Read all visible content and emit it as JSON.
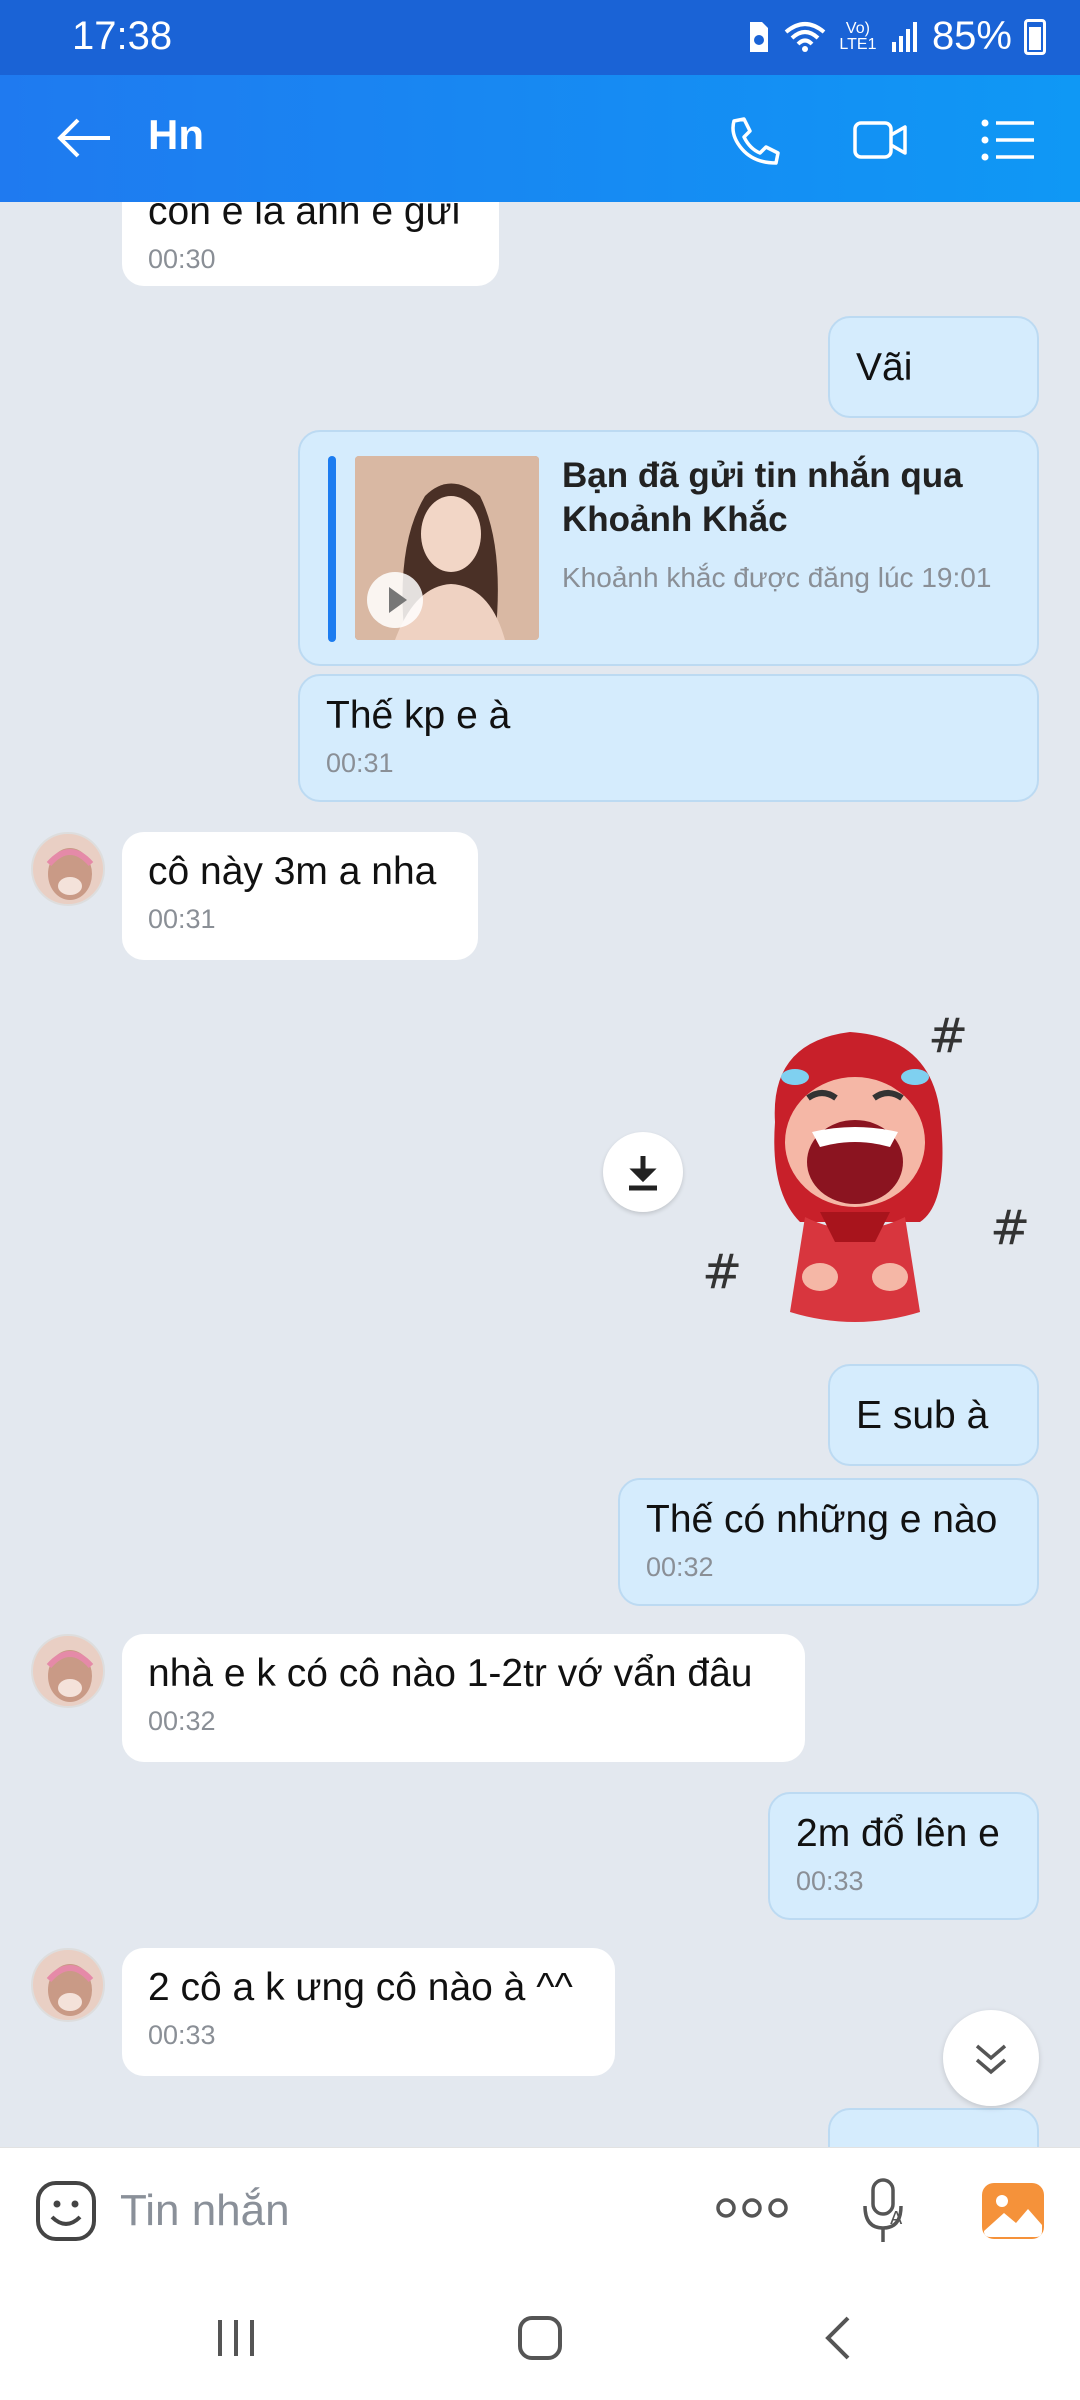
{
  "status": {
    "time": "17:38",
    "battery": "85%",
    "network": "Vo) LTE1"
  },
  "header": {
    "title": "Hn"
  },
  "messages": {
    "m0": {
      "text": "còn e là ảnh e gửi",
      "time": "00:30"
    },
    "m1": {
      "text": "Vãi"
    },
    "m2": {
      "title": "Bạn đã gửi tin nhắn qua Khoảnh Khắc",
      "subtitle": "Khoảnh khắc được đăng lúc 19:01"
    },
    "m3": {
      "text": "Thế kp e à",
      "time": "00:31"
    },
    "m4": {
      "text": "cô này 3m a nha",
      "time": "00:31"
    },
    "m5": {
      "text": "E sub à"
    },
    "m6": {
      "text": "Thế có những e nào",
      "time": "00:32"
    },
    "m7": {
      "text": "nhà e k có cô nào 1-2tr vớ vẩn đâu",
      "time": "00:32"
    },
    "m8": {
      "text": "2m đổ lên e",
      "time": "00:33"
    },
    "m9": {
      "text": "2 cô a k ưng cô nào à ^^",
      "time": "00:33"
    }
  },
  "input": {
    "placeholder": "Tin nhắn"
  },
  "icons": {
    "back": "back-arrow-icon",
    "call": "phone-icon",
    "video": "video-camera-icon",
    "menu": "list-menu-icon",
    "emoji": "emoji-icon",
    "more": "more-dots-icon",
    "mic": "microphone-icon",
    "gallery": "gallery-icon",
    "download": "download-icon",
    "scroll_down": "chevron-double-down-icon"
  },
  "colors": {
    "header": "#1a7ef0",
    "outgoing_bubble": "#d5ecfd",
    "incoming_bubble": "#ffffff",
    "background": "#e3e8ef"
  }
}
